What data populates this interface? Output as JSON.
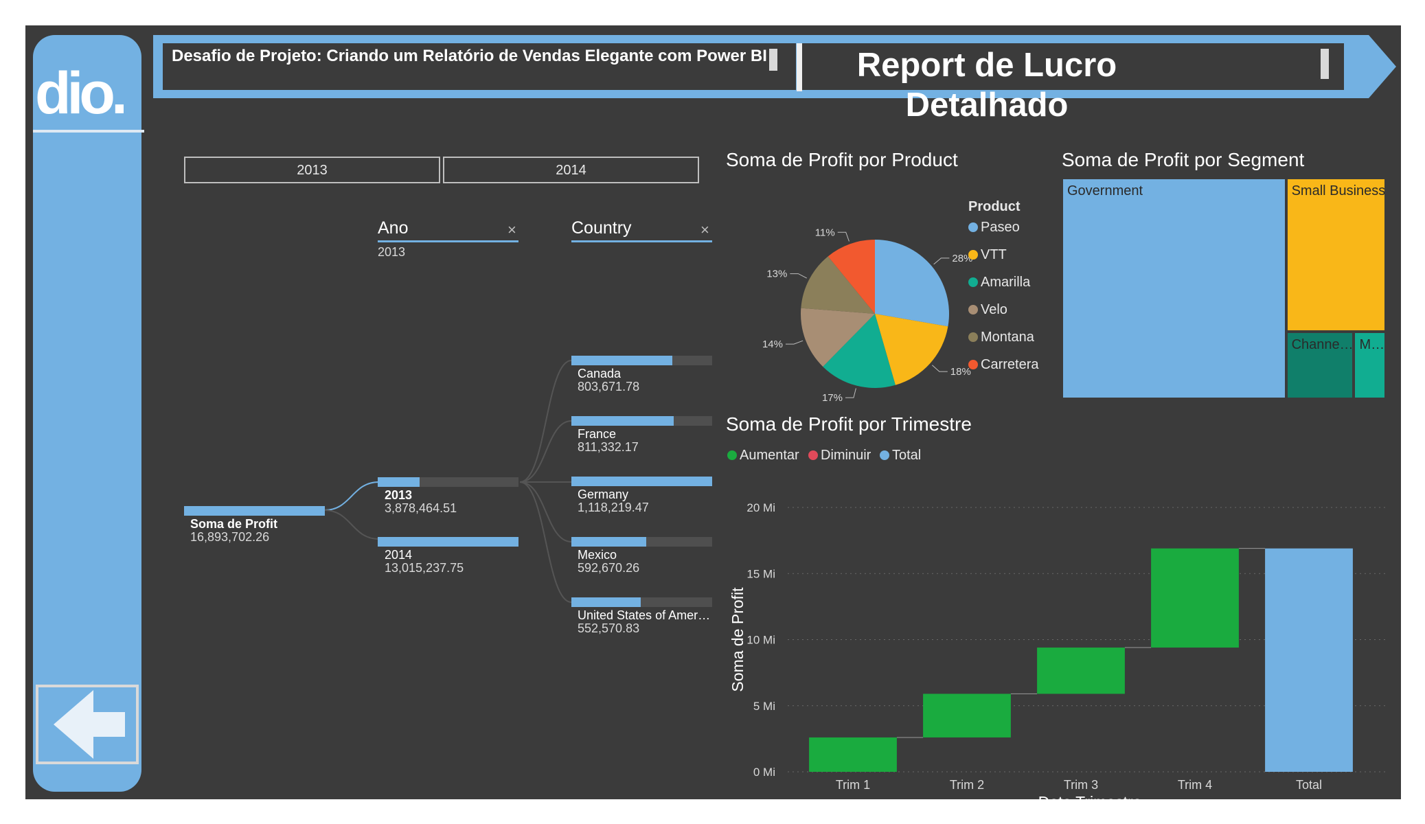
{
  "header": {
    "left_title": "Desafio de Projeto: Criando um Relatório de Vendas Elegante com Power BI",
    "right_title": "Report de Lucro Detalhado"
  },
  "sidebar": {
    "logo_text": "dio.",
    "back_icon": "arrow-left-icon"
  },
  "year_slicer": {
    "options": [
      "2013",
      "2014"
    ]
  },
  "decomposition_tree": {
    "levels": [
      {
        "title": "Ano",
        "selected": "2013",
        "close": "×"
      },
      {
        "title": "Country",
        "close": "×"
      }
    ],
    "root": {
      "label": "Soma de Profit",
      "value": "16,893,702.26"
    },
    "years": [
      {
        "label": "2013",
        "value": "3,878,464.51",
        "fraction": 0.298
      },
      {
        "label": "2014",
        "value": "13,015,237.75",
        "fraction": 1.0
      }
    ],
    "countries": [
      {
        "label": "Canada",
        "value": "803,671.78",
        "fraction": 0.719
      },
      {
        "label": "France",
        "value": "811,332.17",
        "fraction": 0.726
      },
      {
        "label": "Germany",
        "value": "1,118,219.47",
        "fraction": 1.0
      },
      {
        "label": "Mexico",
        "value": "592,670.26",
        "fraction": 0.53
      },
      {
        "label": "United States of Amer…",
        "value": "552,570.83",
        "fraction": 0.494
      }
    ]
  },
  "pie": {
    "title": "Soma de Profit por Product",
    "legend_title": "Product",
    "colors": [
      "#73b1e2",
      "#f9b718",
      "#11ad91",
      "#a88e74",
      "#8b7f5a",
      "#f2592f"
    ]
  },
  "treemap": {
    "title": "Soma de Profit por Segment",
    "items": [
      {
        "label": "Government",
        "color": "#73b1e2"
      },
      {
        "label": "Small Business",
        "color": "#f9b718"
      },
      {
        "label": "Channe…",
        "color": "#107f6a"
      },
      {
        "label": "M…",
        "color": "#11ad91"
      }
    ]
  },
  "waterfall": {
    "title": "Soma de Profit por Trimestre",
    "legend": [
      {
        "label": "Aumentar",
        "color": "#1aab3f"
      },
      {
        "label": "Diminuir",
        "color": "#e14a5a"
      },
      {
        "label": "Total",
        "color": "#73b1e2"
      }
    ]
  },
  "chart_data": [
    {
      "type": "pie",
      "title": "Soma de Profit por Product",
      "categories": [
        "Paseo",
        "VTT",
        "Amarilla",
        "Velo",
        "Montana",
        "Carretera"
      ],
      "values": [
        28,
        18,
        17,
        14,
        13,
        11
      ],
      "data_labels": [
        "28%",
        "18%",
        "17%",
        "14%",
        "13%",
        "11%"
      ],
      "legend_title": "Product",
      "legend_position": "right"
    },
    {
      "type": "waterfall",
      "title": "Soma de Profit por Trimestre",
      "categories": [
        "Trim 1",
        "Trim 2",
        "Trim 3",
        "Trim 4",
        "Total"
      ],
      "values": [
        2.6,
        3.3,
        3.5,
        7.5,
        16.9
      ],
      "xlabel": "Date Trimestre",
      "ylabel": "Soma de Profit",
      "yticks": [
        "0 Mi",
        "5 Mi",
        "10 Mi",
        "15 Mi",
        "20 Mi"
      ],
      "ylim": [
        0,
        20
      ],
      "legend": [
        "Aumentar",
        "Diminuir",
        "Total"
      ],
      "grid": true
    },
    {
      "type": "treemap",
      "title": "Soma de Profit por Segment",
      "categories": [
        "Government",
        "Small Business",
        "Channe…",
        "M…"
      ],
      "values": [
        11.4,
        4.1,
        1.2,
        0.6
      ]
    }
  ]
}
